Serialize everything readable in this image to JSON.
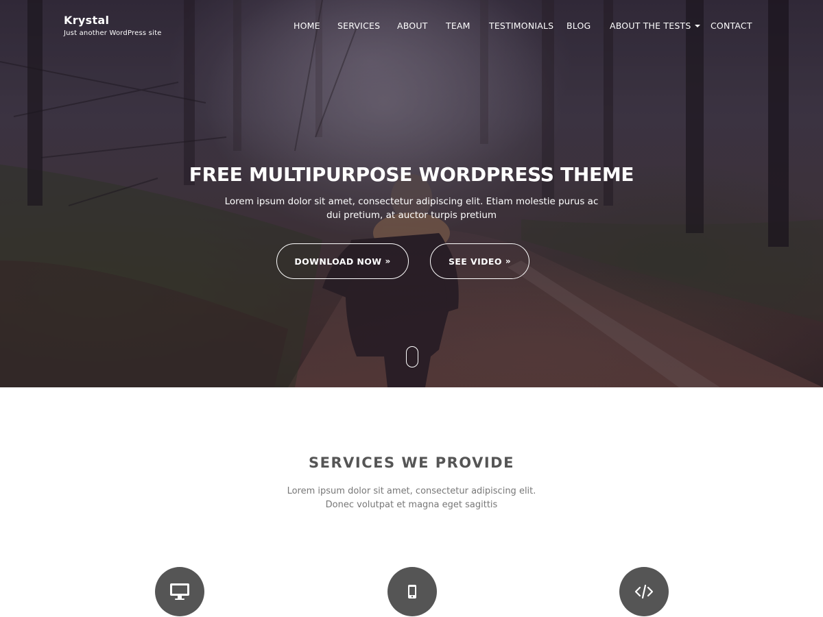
{
  "site": {
    "title": "Krystal",
    "tagline": "Just another WordPress site"
  },
  "nav": {
    "items": [
      {
        "label": "HOME"
      },
      {
        "label": "SERVICES"
      },
      {
        "label": "ABOUT"
      },
      {
        "label": "TEAM"
      },
      {
        "label": "TESTIMONIALS"
      },
      {
        "label": "BLOG"
      },
      {
        "label": "ABOUT THE TESTS",
        "has_dropdown": true
      },
      {
        "label": "CONTACT"
      }
    ]
  },
  "hero": {
    "heading": "FREE MULTIPURPOSE WORDPRESS THEME",
    "subtext": "Lorem ipsum dolor sit amet, consectetur adipiscing elit. Etiam molestie purus ac dui pretium, at auctor turpis pretium",
    "buttons": [
      {
        "label": "DOWNLOAD NOW",
        "icon": "double-chevron-right-icon"
      },
      {
        "label": "SEE VIDEO",
        "icon": "double-chevron-right-icon"
      }
    ],
    "arrow_glyph": "»"
  },
  "services": {
    "title": "SERVICES WE PROVIDE",
    "subtitle_line1": "Lorem ipsum dolor sit amet, consectetur adipiscing elit.",
    "subtitle_line2": "Donec volutpat et magna eget sagittis",
    "icons": [
      "desktop-icon",
      "mobile-icon",
      "code-icon"
    ]
  },
  "colors": {
    "hero_text": "#ffffff",
    "section_title": "#555555",
    "body_text": "#777777",
    "icon_circle": "#555555"
  }
}
